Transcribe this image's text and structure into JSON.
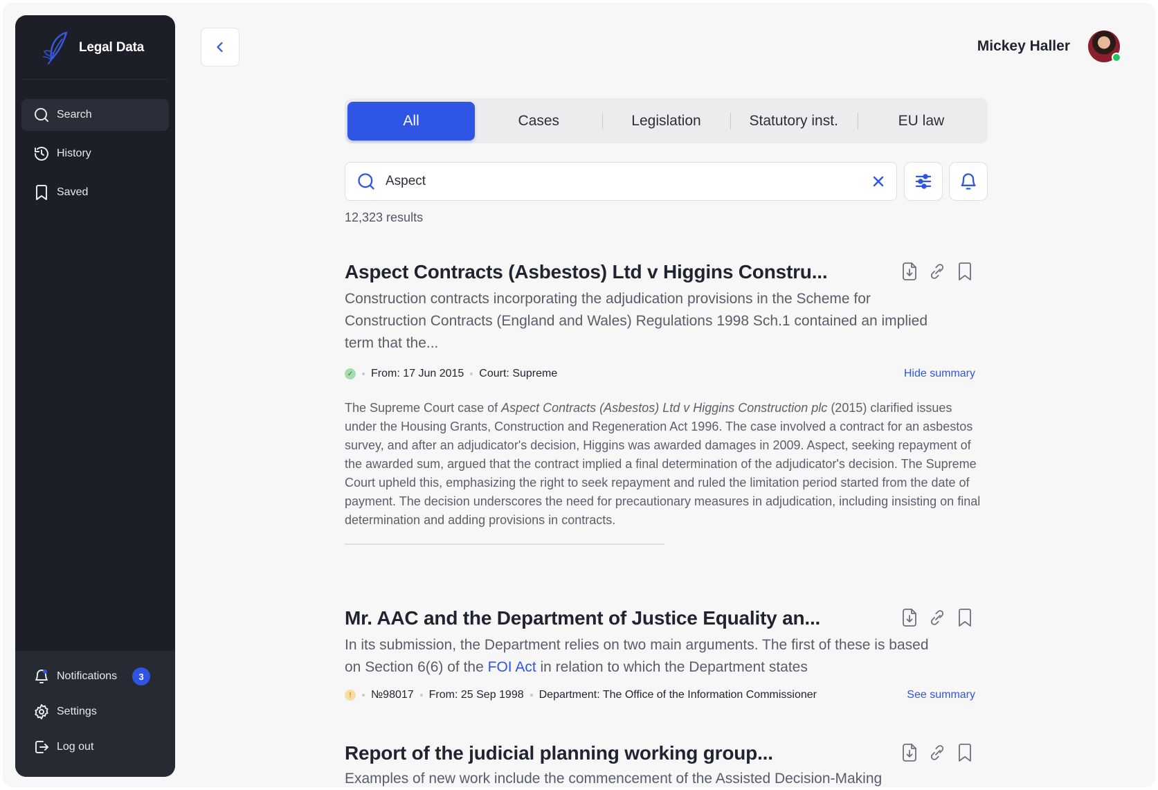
{
  "brand": {
    "name": "Legal Data"
  },
  "sidebar": {
    "items": [
      {
        "label": "Search",
        "icon": "search-icon",
        "active": true
      },
      {
        "label": "History",
        "icon": "history-icon"
      },
      {
        "label": "Saved",
        "icon": "bookmark-icon"
      }
    ],
    "bottom": {
      "notifications_label": "Notifications",
      "notifications_count": "3",
      "settings_label": "Settings",
      "logout_label": "Log out"
    }
  },
  "header": {
    "user_name": "Mickey Haller"
  },
  "tabs": [
    {
      "label": "All",
      "active": true
    },
    {
      "label": "Cases"
    },
    {
      "label": "Legislation"
    },
    {
      "label": "Statutory inst."
    },
    {
      "label": "EU law"
    }
  ],
  "search": {
    "value": "Aspect",
    "placeholder": ""
  },
  "results_count": "12,323 results",
  "colors": {
    "accent": "#2f55e4",
    "sidebar": "#1c1f27",
    "online": "#22c55e"
  },
  "results": [
    {
      "title": "Aspect Contracts (Asbestos) Ltd v Higgins Constru...",
      "snippet": "Construction contracts incorporating the adjudication provisions in the Scheme for Construction Contracts (England and Wales) Regulations 1998 Sch.1 contained an implied term that the...",
      "status": "verified",
      "meta_from": "From: 17 Jun 2015",
      "meta_court": "Court: Supreme",
      "toggle_label": "Hide summary",
      "summary_prefix": "The Supreme Court case of ",
      "summary_italic": "Aspect Contracts (Asbestos) Ltd v Higgins Construction plc",
      "summary_rest": " (2015) clarified issues under the Housing Grants, Construction and Regeneration Act 1996. The case involved a contract for an asbestos survey, and after an adjudicator's decision, Higgins was awarded damages in 2009. Aspect, seeking repayment of the awarded sum, argued that the contract implied a final determination of the adjudicator's decision. The Supreme Court upheld this, emphasizing the right to seek repayment and ruled the limitation period started from the date of payment. The decision underscores the need for precautionary measures in adjudication, including insisting on final determination and adding provisions in contracts."
    },
    {
      "title": "Mr. AAC and the Department of Justice Equality an...",
      "snippet_before": "In its submission, the Department relies on two main arguments. The first of these is based on Section 6(6) of the ",
      "snippet_link": "FOI Act",
      "snippet_after": " in relation to which the Department states",
      "status": "warning",
      "status_glyph": "!",
      "meta_no": "№98017",
      "meta_from": "From: 25 Sep 1998",
      "meta_dept": "Department: The Office of the Information Commissioner",
      "toggle_label": "See summary"
    },
    {
      "title": "Report of the judicial planning working group...",
      "snippet": "Examples of new work include the commencement of the Assisted Decision-Making"
    }
  ]
}
